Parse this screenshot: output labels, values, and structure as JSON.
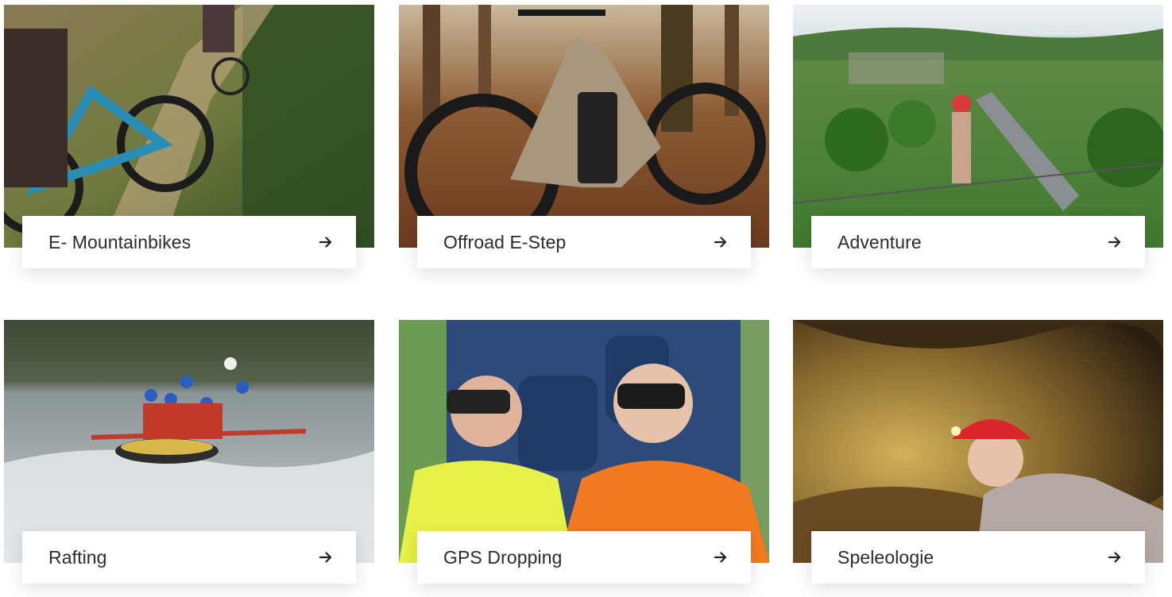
{
  "cards": [
    {
      "title": "E- Mountainbikes",
      "photo": "mountain-bike-trail-photo",
      "icon": "arrow-right-icon"
    },
    {
      "title": "Offroad E-Step",
      "photo": "offroad-e-step-forest-photo",
      "icon": "arrow-right-icon"
    },
    {
      "title": "Adventure",
      "photo": "adventure-rope-bridge-photo",
      "icon": "arrow-right-icon"
    },
    {
      "title": "Rafting",
      "photo": "rafting-river-photo",
      "icon": "arrow-right-icon"
    },
    {
      "title": "GPS Dropping",
      "photo": "gps-dropping-bus-blindfold-photo",
      "icon": "arrow-right-icon"
    },
    {
      "title": "Speleologie",
      "photo": "speleology-cave-photo",
      "icon": "arrow-right-icon"
    }
  ],
  "colors": {
    "label_text": "#2b2b2b",
    "card_bg": "#ffffff",
    "arrow": "#222222"
  }
}
